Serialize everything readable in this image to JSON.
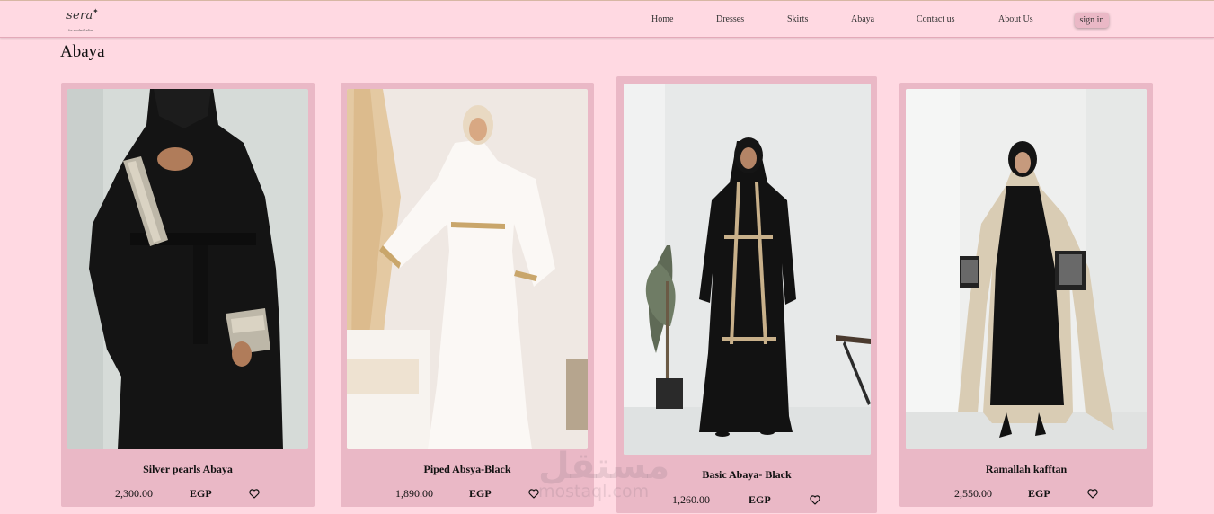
{
  "brand": {
    "name": "sera",
    "tagline": "for modest ladies"
  },
  "nav": {
    "items": [
      {
        "label": "Home"
      },
      {
        "label": "Dresses"
      },
      {
        "label": "Skirts"
      },
      {
        "label": "Abaya"
      },
      {
        "label": "Contact us"
      },
      {
        "label": "About Us"
      }
    ],
    "signin_label": "sign in"
  },
  "page": {
    "title": "Abaya"
  },
  "products": [
    {
      "name": "Silver pearls Abaya",
      "price": "2,300.00",
      "currency": "EGP",
      "garment": "black abaya with silver-pearl cuffs"
    },
    {
      "name": "Piped Absya-Black",
      "price": "1,890.00",
      "currency": "EGP",
      "garment": "white abaya with gold piping"
    },
    {
      "name": "Basic Abaya- Black",
      "price": "1,260.00",
      "currency": "EGP",
      "garment": "black abaya with beige piping"
    },
    {
      "name": "Ramallah kafftan",
      "price": "2,550.00",
      "currency": "EGP",
      "garment": "beige kaftan with embroidered sleeves"
    }
  ],
  "watermark": {
    "arabic": "مستقل",
    "latin": "mostaql.com"
  },
  "colors": {
    "page_bg": "#ffd9e2",
    "card_bg": "#eab8c6",
    "signin_bg": "#eab8c6"
  },
  "icons": {
    "wishlist": "heart-outline-icon"
  }
}
